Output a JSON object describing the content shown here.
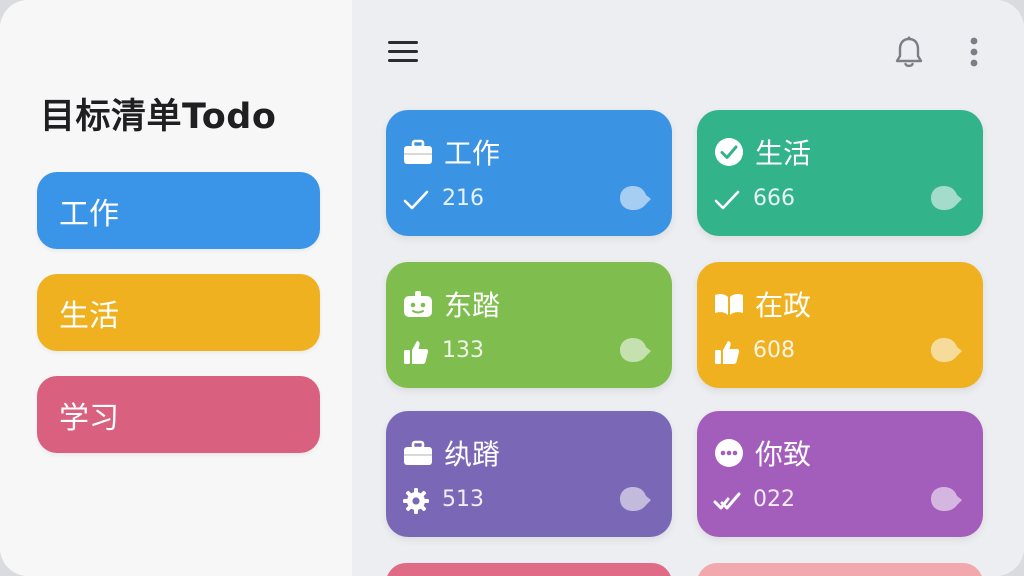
{
  "app": {
    "title": "目标清单Todo"
  },
  "sidebar": {
    "items": [
      {
        "label": "工作",
        "color": "#3a95e8"
      },
      {
        "label": "生活",
        "color": "#efb11f"
      },
      {
        "label": "学习",
        "color": "#d9607f"
      }
    ]
  },
  "topbar": {
    "menu_icon": "hamburger-icon",
    "bell_icon": "bell-icon",
    "more_icon": "more-vertical-icon"
  },
  "cards": [
    {
      "title": "工作",
      "count": "216",
      "color": "#3b93e3",
      "head_icon": "briefcase-icon",
      "stat_icon": "check-icon"
    },
    {
      "title": "生活",
      "count": "666",
      "color": "#33b38a",
      "head_icon": "check-circle-icon",
      "stat_icon": "check-icon"
    },
    {
      "title": "东踏",
      "count": "133",
      "color": "#7ebd4e",
      "head_icon": "robot-icon",
      "stat_icon": "thumb-icon"
    },
    {
      "title": "在政",
      "count": "608",
      "color": "#efb11f",
      "head_icon": "book-icon",
      "stat_icon": "thumb-icon"
    },
    {
      "title": "纨蹐",
      "count": "513",
      "color": "#7a68b6",
      "head_icon": "briefcase-icon",
      "stat_icon": "gear-icon"
    },
    {
      "title": "你致",
      "count": "022",
      "color": "#a35dba",
      "head_icon": "ellipsis-circle-icon",
      "stat_icon": "double-check-icon"
    }
  ],
  "partial_cards": [
    {
      "color": "#e06b86"
    },
    {
      "color": "#f1a9ad"
    }
  ]
}
